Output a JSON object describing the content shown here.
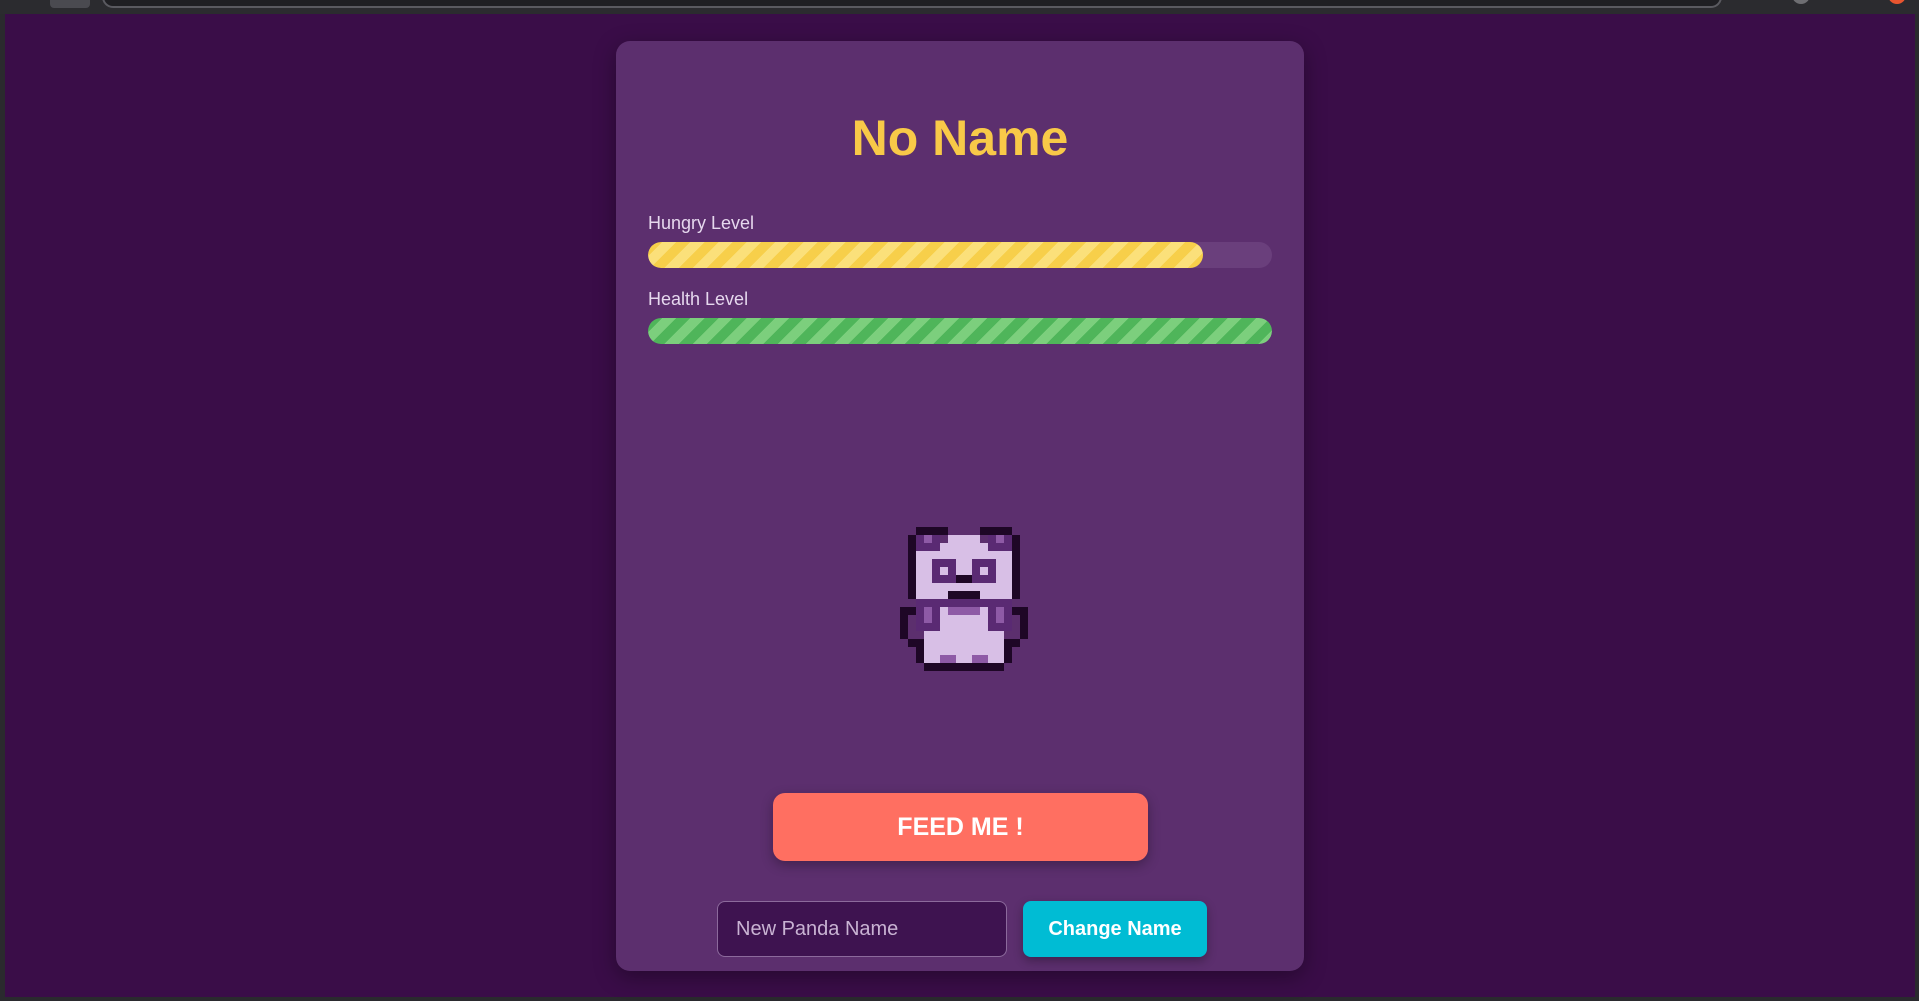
{
  "pet": {
    "name": "No Name"
  },
  "meters": {
    "hungry": {
      "label": "Hungry Level",
      "value": 0.89,
      "color": "#f7cf4a"
    },
    "health": {
      "label": "Health Level",
      "value": 1.0,
      "color": "#4fb55a"
    }
  },
  "sprite": {
    "icon": "panda-sprite-icon",
    "colors": {
      "outline": "#1e0726",
      "dark": "#5a2a73",
      "mid": "#8e5aa6",
      "light": "#d8bfe6"
    }
  },
  "actions": {
    "feed_label": "FEED ME !",
    "feed_color": "#ff6f61",
    "name_placeholder": "New Panda Name",
    "change_name_label": "Change Name",
    "change_name_color": "#00bcd4"
  },
  "theme": {
    "page_background": "#3a0d48",
    "card_background": "#5c2f6e",
    "title_color": "#f8c948"
  }
}
